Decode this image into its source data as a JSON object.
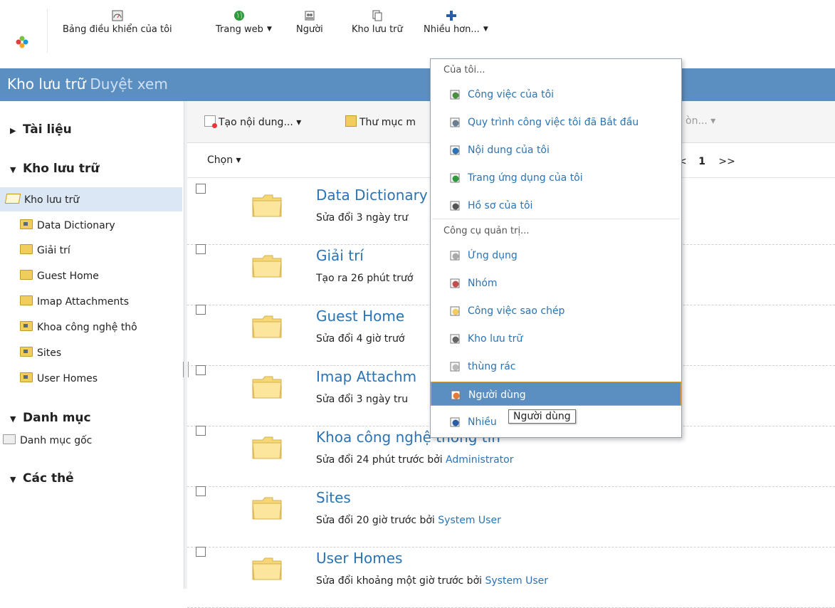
{
  "nav": {
    "items": [
      {
        "label": "Bảng điều khiển của tôi",
        "icon": "dashboard-icon"
      },
      {
        "label": "Trang web",
        "icon": "globe-icon"
      },
      {
        "label": "Người",
        "icon": "people-icon"
      },
      {
        "label": "Kho lưu trữ",
        "icon": "repository-icon"
      },
      {
        "label": "Nhiều hơn...",
        "icon": "plus-icon"
      }
    ]
  },
  "header": {
    "title": "Kho lưu trữ",
    "subtitle": "Duyệt xem"
  },
  "sidebar": {
    "documents": "Tài liệu",
    "repository": "Kho lưu trữ",
    "tree_root": "Kho lưu trữ",
    "tree_items": [
      "Data Dictionary",
      "Giải trí",
      "Guest Home",
      "Imap Attachments",
      "Khoa công nghệ thô",
      "Sites",
      "User Homes"
    ],
    "categories": "Danh mục",
    "category_root": "Danh mục gốc",
    "tags": "Các thẻ"
  },
  "toolbar": {
    "create": "Tạo nội dung... ▾",
    "new_folder": "Thư mục m",
    "more": "òn... ▾",
    "select": "Chọn ▾",
    "page": "1",
    "next": ">>",
    "prev": "<"
  },
  "rows": [
    {
      "title": "Data Dictionary",
      "meta": "Sửa đổi 3 ngày trư",
      "user": ""
    },
    {
      "title": "Giải trí",
      "meta": "Tạo ra 26 phút trướ",
      "user": ""
    },
    {
      "title": "Guest Home",
      "meta": "Sửa đổi 4 giờ trướ",
      "user": ""
    },
    {
      "title": "Imap Attachm",
      "meta": "Sửa đổi 3 ngày tru",
      "user": ""
    },
    {
      "title": "Khoa công nghệ thông tin",
      "meta": "Sửa đổi 24 phút trước bởi ",
      "user": "Administrator"
    },
    {
      "title": "Sites",
      "meta": "Sửa đổi 20 giờ trước bởi ",
      "user": "System User"
    },
    {
      "title": "User Homes",
      "meta": "Sửa đổi khoảng một giờ trước bởi ",
      "user": "System User"
    }
  ],
  "menu": {
    "group1": "Của tôi...",
    "mine": [
      {
        "label": "Công việc của tôi",
        "icon": "tasks-icon"
      },
      {
        "label": "Quy trình công việc tôi đã Bắt đầu",
        "icon": "workflow-icon"
      },
      {
        "label": "Nội dung của tôi",
        "icon": "content-icon"
      },
      {
        "label": "Trang ứng dụng của tôi",
        "icon": "site-icon"
      },
      {
        "label": "Hồ sơ của tôi",
        "icon": "profile-icon"
      }
    ],
    "group2": "Công cụ quản trị...",
    "admin": [
      {
        "label": "Ứng dụng",
        "icon": "app-icon"
      },
      {
        "label": "Nhóm",
        "icon": "group-icon"
      },
      {
        "label": "Công việc sao chép",
        "icon": "replication-icon"
      },
      {
        "label": "Kho lưu trữ",
        "icon": "repository-icon"
      },
      {
        "label": "thùng rác",
        "icon": "trash-icon"
      },
      {
        "label": "Người dùng",
        "icon": "users-icon"
      },
      {
        "label": "Nhiều",
        "icon": "plus-icon"
      }
    ]
  },
  "tooltip": "Người dùng",
  "colors": {
    "accent": "#5b8fc1",
    "link": "#2a73b4",
    "highlight_border": "#d8a23c"
  }
}
